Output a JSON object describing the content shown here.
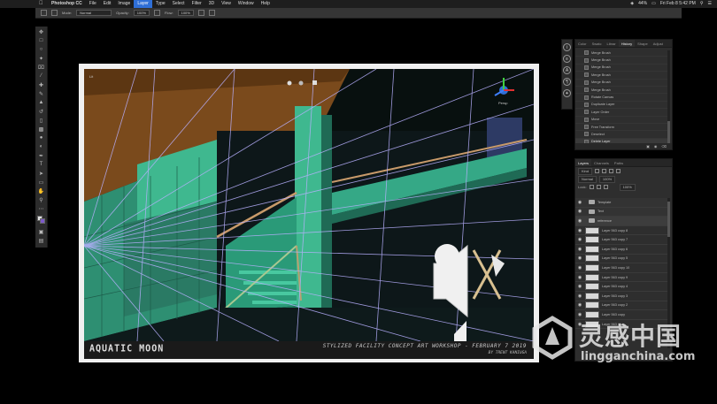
{
  "menubar": {
    "app_name": "Photoshop CC",
    "items": [
      "File",
      "Edit",
      "Image",
      "Layer",
      "Type",
      "Select",
      "Filter",
      "3D",
      "View",
      "Window",
      "Help"
    ],
    "active_item": "Layer",
    "battery": "44%",
    "clock": "Fri Feb 8  5:42 PM"
  },
  "options_bar": {
    "mode_label": "Mode:",
    "mode_value": "Normal",
    "opacity_label": "Opacity:",
    "opacity_value": "100%",
    "flow_label": "Flow:",
    "flow_value": "100%"
  },
  "history_panel": {
    "tabs": [
      "Color",
      "Swatc",
      "Librar",
      "History",
      "Shape",
      "Adjust"
    ],
    "active_tab": "History",
    "rows": [
      "Merge Brush",
      "Merge Brush",
      "Merge Brush",
      "Merge Brush",
      "Merge Brush",
      "Merge Brush",
      "Rotate Canvas",
      "Duplicate Layer",
      "Layer Order",
      "Move",
      "Free Transform",
      "Deselect",
      "Delete Layer"
    ],
    "selected_row": 12
  },
  "layers_panel": {
    "tabs": [
      "Layers",
      "Channels",
      "Paths"
    ],
    "active_tab": "Layers",
    "kind_label": "Kind",
    "blend_mode": "Normal",
    "opacity_value": "100%",
    "lock_label": "Lock:",
    "fill_value": "100%",
    "rows": [
      {
        "name": "Template",
        "type": "group"
      },
      {
        "name": "Text",
        "type": "group"
      },
      {
        "name": "reference",
        "type": "group-open"
      },
      {
        "name": "Layer 563 copy 8",
        "type": "layer"
      },
      {
        "name": "Layer 563 copy 7",
        "type": "layer"
      },
      {
        "name": "Layer 563 copy 6",
        "type": "layer"
      },
      {
        "name": "Layer 563 copy 5",
        "type": "layer"
      },
      {
        "name": "Layer 563 copy 10",
        "type": "layer"
      },
      {
        "name": "Layer 563 copy 9",
        "type": "layer"
      },
      {
        "name": "Layer 563 copy 4",
        "type": "layer"
      },
      {
        "name": "Layer 563 copy 3",
        "type": "layer"
      },
      {
        "name": "Layer 563 copy 2",
        "type": "layer"
      },
      {
        "name": "Layer 563 copy",
        "type": "layer"
      },
      {
        "name": "Layer 563",
        "type": "layer"
      }
    ]
  },
  "artwork": {
    "title_left": "AQUATIC MOON",
    "title_right": "STYLIZED FACILITY CONCEPT ART WORKSHOP - FEBRUARY 7 2019",
    "byline": "BY TRENT KANIUGA",
    "viewport_label": "Persp",
    "corner_label": "Lit"
  },
  "watermark": {
    "chinese": "灵感中国",
    "url": "lingganchina.com"
  },
  "colors": {
    "accent_blue": "#2f6fd6",
    "teal_wall": "#3fb88f",
    "ceiling_orange": "#7a4a1c",
    "perspective_lines": "#b8b0ff"
  }
}
